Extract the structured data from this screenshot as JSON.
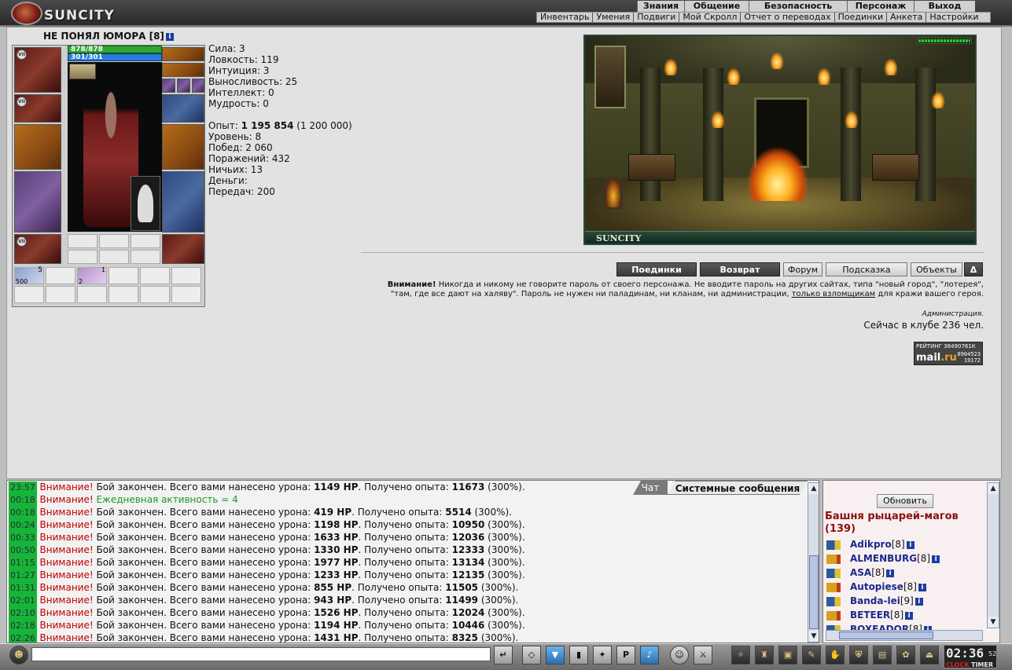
{
  "header": {
    "logo": "SUNCITY",
    "menu_top": [
      "Знания",
      "Общение",
      "Безопасность",
      "Персонаж",
      "Выход"
    ],
    "menu_sub": [
      "Инвентарь",
      "Умения",
      "Подвиги",
      "Мой Скролл",
      "Отчет о переводах",
      "Поединки",
      "Анкета",
      "Настройки"
    ]
  },
  "character": {
    "name": "НЕ ПОНЯЛ ЮМОРА",
    "level": "[8]",
    "hp": "878/878",
    "mana": "301/301",
    "inv_counts": [
      "5",
      "500",
      "2",
      "1"
    ]
  },
  "stats": {
    "strength": "Сила: 3",
    "agility": "Ловкость: 119",
    "intuition": "Интуиция: 3",
    "endurance": "Выносливость: 25",
    "intellect": "Интеллект: 0",
    "wisdom": "Мудрость: 0",
    "exp_label": "Опыт: ",
    "exp_value": "1 195 854",
    "exp_next": "(1 200 000)",
    "level": "Уровень: 8",
    "wins": "Побед: 2 060",
    "losses": "Поражений: 432",
    "draws": "Ничьих: 13",
    "money": "Деньги:",
    "transfers": "Передач: 200"
  },
  "scene": {
    "caption": "SUNCITY"
  },
  "nav_buttons": [
    "Поединки",
    "Возврат",
    "Форум",
    "Подсказка",
    "Объекты",
    "Δ"
  ],
  "warning": {
    "bold": "Внимание!",
    "text1": " Никогда и никому не говорите пароль от своего персонажа. Не вводите пароль на других сайтах, типа \"новый город\", \"лотерея\", \"там, где все дают на халяву\". Пароль не нужен ни паладинам, ни кланам, ни администрации, ",
    "link": "только взломщикам",
    "text2": " для кражи вашего героя.",
    "signature": "Администрация.",
    "online": "Сейчас в клубе 236 чел."
  },
  "counter": {
    "title": "РЕЙТИНГ",
    "brand_left": "mail",
    "brand_right": ".ru",
    "n1": "38490761К",
    "n2": "8904523",
    "n3": "19172"
  },
  "chat": {
    "tabs": [
      "Чат",
      "Системные сообщения"
    ],
    "lines": [
      {
        "time": "23:57",
        "warn": "Внимание!",
        "text": " Бой закончен. Всего вами нанесено урона: ",
        "dmg": "1149 HP",
        "mid": ". Получено опыта: ",
        "exp": "11673",
        "tail": " (300%)."
      },
      {
        "time": "00:18",
        "warn": "Внимание!",
        "green": " Ежедневная активность = 4"
      },
      {
        "time": "00:18",
        "warn": "Внимание!",
        "text": " Бой закончен. Всего вами нанесено урона: ",
        "dmg": "419 HP",
        "mid": ". Получено опыта: ",
        "exp": "5514",
        "tail": " (300%)."
      },
      {
        "time": "00:24",
        "warn": "Внимание!",
        "text": " Бой закончен. Всего вами нанесено урона: ",
        "dmg": "1198 HP",
        "mid": ". Получено опыта: ",
        "exp": "10950",
        "tail": " (300%)."
      },
      {
        "time": "00:33",
        "warn": "Внимание!",
        "text": " Бой закончен. Всего вами нанесено урона: ",
        "dmg": "1633 HP",
        "mid": ". Получено опыта: ",
        "exp": "12036",
        "tail": " (300%)."
      },
      {
        "time": "00:50",
        "warn": "Внимание!",
        "text": " Бой закончен. Всего вами нанесено урона: ",
        "dmg": "1330 HP",
        "mid": ". Получено опыта: ",
        "exp": "12333",
        "tail": " (300%)."
      },
      {
        "time": "01:15",
        "warn": "Внимание!",
        "text": " Бой закончен. Всего вами нанесено урона: ",
        "dmg": "1977 HP",
        "mid": ". Получено опыта: ",
        "exp": "13134",
        "tail": " (300%)."
      },
      {
        "time": "01:27",
        "warn": "Внимание!",
        "text": " Бой закончен. Всего вами нанесено урона: ",
        "dmg": "1233 HP",
        "mid": ". Получено опыта: ",
        "exp": "12135",
        "tail": " (300%)."
      },
      {
        "time": "01:31",
        "warn": "Внимание!",
        "text": " Бой закончен. Всего вами нанесено урона: ",
        "dmg": "855 HP",
        "mid": ". Получено опыта: ",
        "exp": "11505",
        "tail": " (300%)."
      },
      {
        "time": "02:01",
        "warn": "Внимание!",
        "text": " Бой закончен. Всего вами нанесено урона: ",
        "dmg": "943 HP",
        "mid": ". Получено опыта: ",
        "exp": "11499",
        "tail": " (300%)."
      },
      {
        "time": "02:10",
        "warn": "Внимание!",
        "text": " Бой закончен. Всего вами нанесено урона: ",
        "dmg": "1526 HP",
        "mid": ". Получено опыта: ",
        "exp": "12024",
        "tail": " (300%)."
      },
      {
        "time": "02:18",
        "warn": "Внимание!",
        "text": " Бой закончен. Всего вами нанесено урона: ",
        "dmg": "1194 HP",
        "mid": ". Получено опыта: ",
        "exp": "10446",
        "tail": " (300%)."
      },
      {
        "time": "02:26",
        "warn": "Внимание!",
        "text": " Бой закончен. Всего вами нанесено урона: ",
        "dmg": "1431 HP",
        "mid": ". Получено опыта: ",
        "exp": "8325",
        "tail": " (300%)."
      }
    ]
  },
  "online_list": {
    "refresh": "Обновить",
    "room": "Башня рыцарей-магов (139)",
    "players": [
      {
        "name": "Adikpro",
        "level": "[8]"
      },
      {
        "name": "ALMENBURG",
        "level": "[8]"
      },
      {
        "name": "ASA",
        "level": "[8]"
      },
      {
        "name": "Autopiese",
        "level": "[8]"
      },
      {
        "name": "Banda-lei",
        "level": "[9]"
      },
      {
        "name": "BETEER",
        "level": "[8]"
      },
      {
        "name": "BOXEADOR",
        "level": "[8]"
      }
    ]
  },
  "bottom": {
    "clock": "02:36",
    "seconds": "52",
    "clock_label": "CLOCK",
    "timer_label": "TIMER"
  }
}
